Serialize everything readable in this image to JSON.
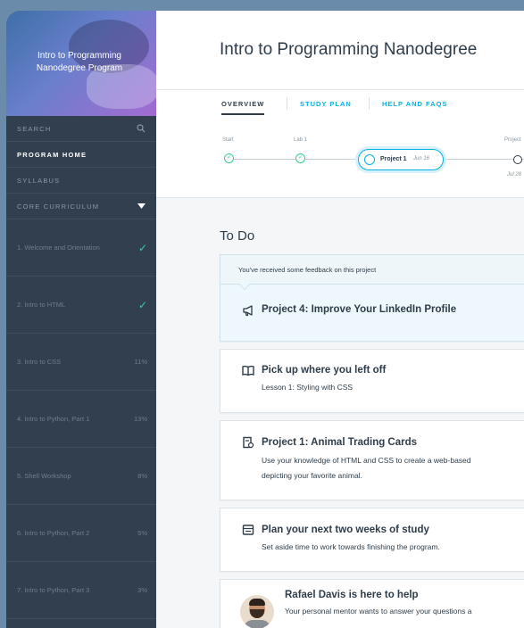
{
  "sidebar": {
    "program_title": "Intro to Programming Nanodegree Program",
    "search_label": "SEARCH",
    "program_home": "PROGRAM HOME",
    "syllabus": "SYLLABUS",
    "core_curriculum": "CORE CURRICULUM",
    "lessons": [
      {
        "label": "1.  Welcome and Orientation",
        "status": "complete"
      },
      {
        "label": "2.  Intro to HTML",
        "status": "complete"
      },
      {
        "label": "3.  Intro to CSS",
        "progress": "11%"
      },
      {
        "label": "4.  Intro to Python, Part 1",
        "progress": "13%"
      },
      {
        "label": "5.  Shell Workshop",
        "progress": "8%"
      },
      {
        "label": "6.  Intro to Python, Part 2",
        "progress": "5%"
      },
      {
        "label": "7.  Intro to Python, Part 3",
        "progress": "3%"
      }
    ]
  },
  "header": {
    "title": "Intro to Programming Nanodegree"
  },
  "tabs": [
    "OVERVIEW",
    "STUDY PLAN",
    "HELP AND FAQS"
  ],
  "timeline": {
    "start_label": "Start",
    "lab1_label": "Lab 1",
    "current_project": "Project 1",
    "current_date": "Jun 16",
    "next_label": "Project",
    "next_date": "Jul 28"
  },
  "todo": {
    "title": "To Do",
    "feedback_notice": "You've received some feedback on this project",
    "feedback_project": "Project 4: Improve Your LinkedIn Profile",
    "resume_title": "Pick up where you left off",
    "resume_sub": "Lesson 1: Styling with CSS",
    "project_title": "Project 1: Animal Trading Cards",
    "project_sub_line1": "Use your knowledge of HTML and CSS to create a web-based",
    "project_sub_line2": "depicting your favorite animal.",
    "plan_title": "Plan your next two weeks of study",
    "plan_sub": "Set aside time to work towards finishing the program.",
    "mentor_title": "Rafael Davis is here to help",
    "mentor_sub": "Your personal mentor wants to answer your questions a"
  },
  "colors": {
    "sidebar_bg": "#323f4e",
    "accent": "#02b3e4",
    "complete": "#2ad6a3"
  }
}
